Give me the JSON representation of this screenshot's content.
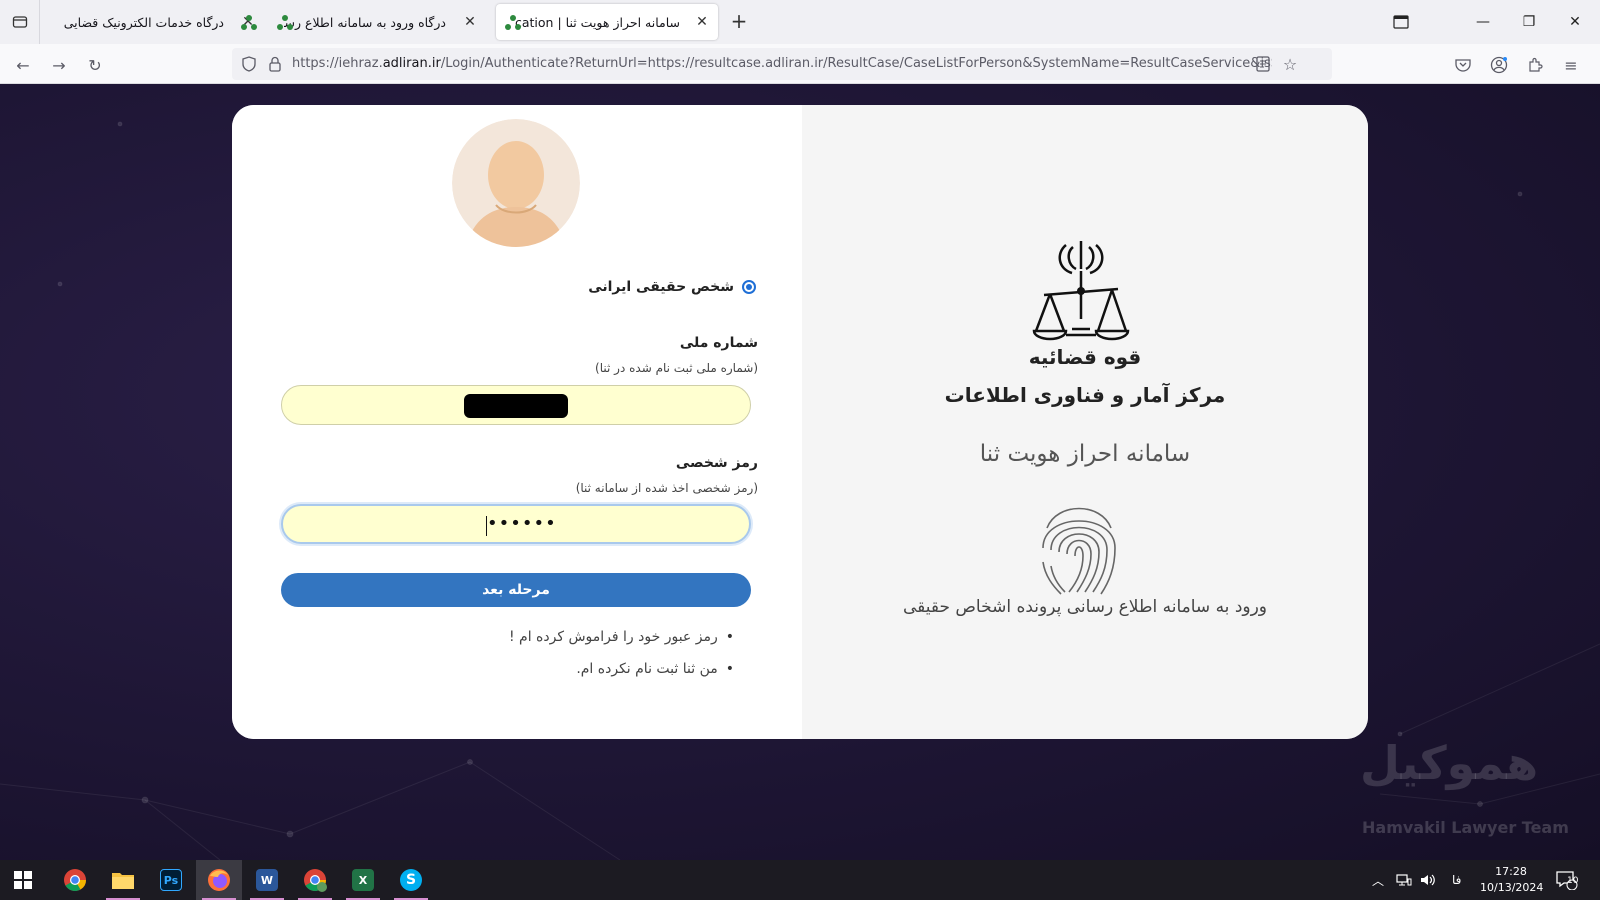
{
  "browser": {
    "tabs": [
      {
        "title": "درگاه خدمات الکترونیک قضایی",
        "active": false
      },
      {
        "title": "درگاه ورود به سامانه اطلاع رسانی",
        "active": false
      },
      {
        "title": "سامانه احراز هویت ثنا | Authentication",
        "active": true
      }
    ],
    "url": {
      "prefix": "https://iehraz.",
      "host": "adliran.ir",
      "rest": "/Login/Authenticate?ReturnUrl=https://resultcase.adliran.ir/ResultCase/CaseListForPerson&SystemName=ResultCaseService&isSelectNatur"
    },
    "accent": "#1f6fd6"
  },
  "login": {
    "person_type_label": "شخص حقیقی ایرانی",
    "national_id": {
      "label": "شماره ملی",
      "hint": "(شماره ملی ثبت نام شده در ثنا)",
      "value_redacted": true
    },
    "password": {
      "label": "رمز شخصی",
      "hint": "(رمز شخصی اخذ شده از سامانه ثنا)",
      "masked_value": "••••••"
    },
    "submit_label": "مرحله بعد",
    "links": [
      "رمز عبور خود را فراموش کرده ام !",
      "من ثنا ثبت نام نکرده ام."
    ],
    "submit_color": "#3375c0",
    "input_color": "#ffffd0"
  },
  "branding": {
    "org_name": "قوه قضائیه",
    "center_name": "مرکز آمار و فناوری اطلاعات",
    "system_name": "سامانه احراز هویت ثنا",
    "caption": "ورود به سامانه اطلاع رسانی پرونده اشخاص حقیقی"
  },
  "watermark": {
    "fa": "هموکیل",
    "en": "Hamvakil Lawyer Team"
  },
  "taskbar": {
    "apps": [
      "chrome",
      "file-explorer",
      "photoshop",
      "firefox",
      "word",
      "chrome-profile",
      "excel",
      "skype"
    ],
    "lang": "فا",
    "time": "17:28",
    "date": "10/13/2024",
    "notification_count": "10"
  }
}
